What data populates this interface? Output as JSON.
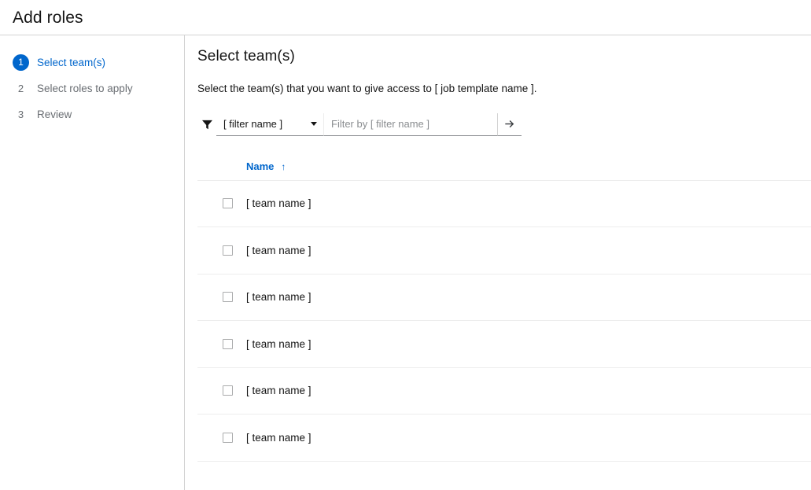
{
  "header": {
    "title": "Add roles"
  },
  "sidebar": {
    "steps": [
      {
        "number": "1",
        "label": "Select team(s)",
        "active": true
      },
      {
        "number": "2",
        "label": "Select roles to apply",
        "active": false
      },
      {
        "number": "3",
        "label": "Review",
        "active": false
      }
    ]
  },
  "main": {
    "title": "Select team(s)",
    "description": "Select the team(s) that you want to give access to [ job template name ].",
    "toolbar": {
      "filter_icon": "funnel-icon",
      "filter_select_value": "[ filter name ]",
      "filter_select_options": [
        "[ filter name ]"
      ],
      "filter_input_value": "",
      "filter_input_placeholder": "Filter by [ filter name ]",
      "search_button_icon": "arrow-right-icon"
    },
    "table": {
      "columns": [
        {
          "label": "Name",
          "sort": "ascending",
          "sort_icon": "↑"
        }
      ],
      "rows": [
        {
          "checked": false,
          "name": "[ team name ]"
        },
        {
          "checked": false,
          "name": "[ team name ]"
        },
        {
          "checked": false,
          "name": "[ team name ]"
        },
        {
          "checked": false,
          "name": "[ team name ]"
        },
        {
          "checked": false,
          "name": "[ team name ]"
        },
        {
          "checked": false,
          "name": "[ team name ]"
        }
      ]
    }
  },
  "colors": {
    "accent": "#0066cc",
    "text": "#151515",
    "muted": "#6a6e73",
    "border": "#d2d2d2",
    "divider": "#ededed"
  }
}
